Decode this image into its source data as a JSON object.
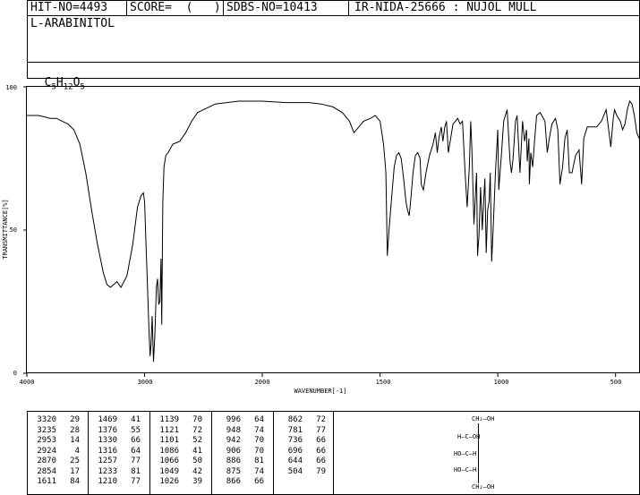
{
  "header": {
    "hit": "HIT-NO=4493",
    "score": "SCORE=  (   )",
    "sdbs": "SDBS-NO=10413",
    "ir": "IR-NIDA-25666 : NUJOL MULL",
    "compound": "L-ARABINITOL",
    "formula": {
      "c": "C",
      "c_n": "5",
      "h": "H",
      "h_n": "12",
      "o": "O",
      "o_n": "5"
    }
  },
  "chart_data": {
    "type": "line",
    "xlabel": "WAVENUMBER[-1]",
    "ylabel": "TRANSMITTANCE[%]",
    "xlim": [
      4000,
      400
    ],
    "ylim": [
      0,
      100
    ],
    "x_ticks": [
      "4000",
      "3000",
      "2000",
      "1500",
      "1000",
      "500"
    ],
    "y_ticks": [
      "100",
      "50",
      "0"
    ],
    "series": [
      {
        "x": [
          4000,
          3900,
          3800,
          3750,
          3700,
          3650,
          3600,
          3550,
          3500,
          3450,
          3400,
          3350,
          3320,
          3290,
          3260,
          3235,
          3200,
          3150,
          3100,
          3060,
          3030,
          3010,
          3000,
          2990,
          2975,
          2960,
          2953,
          2945,
          2935,
          2924,
          2912,
          2900,
          2890,
          2880,
          2870,
          2860,
          2854,
          2845,
          2835,
          2820,
          2800,
          2760,
          2700,
          2650,
          2600,
          2550,
          2500,
          2450,
          2400,
          2300,
          2200,
          2100,
          2000,
          1900,
          1800,
          1750,
          1700,
          1660,
          1630,
          1611,
          1590,
          1570,
          1540,
          1520,
          1500,
          1485,
          1475,
          1469,
          1462,
          1450,
          1440,
          1430,
          1420,
          1410,
          1400,
          1390,
          1383,
          1376,
          1368,
          1360,
          1350,
          1340,
          1330,
          1325,
          1316,
          1305,
          1290,
          1275,
          1265,
          1257,
          1250,
          1240,
          1233,
          1225,
          1218,
          1210,
          1200,
          1190,
          1180,
          1170,
          1160,
          1150,
          1139,
          1130,
          1121,
          1115,
          1110,
          1101,
          1095,
          1090,
          1086,
          1080,
          1073,
          1066,
          1060,
          1055,
          1049,
          1043,
          1037,
          1032,
          1026,
          1020,
          1010,
          1000,
          996,
          985,
          975,
          960,
          948,
          942,
          935,
          925,
          918,
          912,
          906,
          895,
          886,
          878,
          875,
          868,
          866,
          860,
          852,
          845,
          835,
          820,
          800,
          790,
          781,
          770,
          755,
          745,
          736,
          725,
          715,
          705,
          696,
          685,
          670,
          655,
          644,
          635,
          620,
          600,
          580,
          560,
          540,
          520,
          510,
          504,
          495,
          480,
          470,
          460,
          450,
          440,
          430,
          420,
          410,
          400
        ],
        "y": [
          90,
          90,
          89,
          89,
          88,
          87,
          85,
          80,
          70,
          57,
          45,
          35,
          31,
          30,
          31,
          32,
          30,
          34,
          45,
          58,
          62,
          63,
          60,
          48,
          30,
          12,
          6,
          10,
          20,
          4,
          14,
          30,
          33,
          24,
          25,
          40,
          17,
          60,
          72,
          76,
          77,
          80,
          81,
          84,
          88,
          91,
          92,
          93,
          94,
          94.5,
          95,
          95,
          95,
          94.5,
          94.5,
          94,
          93,
          91,
          88,
          84,
          86,
          88,
          89,
          90,
          88,
          80,
          70,
          41,
          50,
          62,
          72,
          76,
          77,
          75,
          68,
          60,
          57,
          55,
          62,
          70,
          76,
          77,
          75,
          66,
          64,
          70,
          76,
          80,
          84,
          77,
          82,
          86,
          81,
          86,
          88,
          77,
          82,
          87,
          88,
          89,
          87,
          88,
          70,
          58,
          72,
          88,
          78,
          52,
          62,
          70,
          41,
          48,
          65,
          50,
          60,
          68,
          42,
          57,
          60,
          70,
          39,
          50,
          70,
          85,
          64,
          76,
          88,
          92,
          74,
          70,
          75,
          88,
          90,
          80,
          70,
          88,
          81,
          85,
          74,
          82,
          66,
          77,
          72,
          80,
          90,
          91,
          88,
          77,
          82,
          87,
          89,
          85,
          66,
          72,
          82,
          85,
          70,
          70,
          76,
          78,
          66,
          82,
          86,
          86,
          86,
          88,
          92,
          79,
          89,
          92,
          90,
          88,
          85,
          87,
          92,
          95,
          94,
          90,
          84,
          82
        ]
      }
    ]
  },
  "peak_table": [
    [
      [
        "3320",
        "29"
      ],
      [
        "3235",
        "28"
      ],
      [
        "2953",
        "14"
      ],
      [
        "2924",
        "4"
      ],
      [
        "2870",
        "25"
      ],
      [
        "2854",
        "17"
      ],
      [
        "1611",
        "84"
      ]
    ],
    [
      [
        "1469",
        "41"
      ],
      [
        "1376",
        "55"
      ],
      [
        "1330",
        "66"
      ],
      [
        "1316",
        "64"
      ],
      [
        "1257",
        "77"
      ],
      [
        "1233",
        "81"
      ],
      [
        "1210",
        "77"
      ]
    ],
    [
      [
        "1139",
        "70"
      ],
      [
        "1121",
        "72"
      ],
      [
        "1101",
        "52"
      ],
      [
        "1086",
        "41"
      ],
      [
        "1066",
        "50"
      ],
      [
        "1049",
        "42"
      ],
      [
        "1026",
        "39"
      ]
    ],
    [
      [
        "996",
        "64"
      ],
      [
        "948",
        "74"
      ],
      [
        "942",
        "70"
      ],
      [
        "906",
        "70"
      ],
      [
        "886",
        "81"
      ],
      [
        "875",
        "74"
      ],
      [
        "866",
        "66"
      ]
    ],
    [
      [
        "862",
        "72"
      ],
      [
        "781",
        "77"
      ],
      [
        "736",
        "66"
      ],
      [
        "696",
        "66"
      ],
      [
        "644",
        "66"
      ],
      [
        "504",
        "79"
      ]
    ]
  ],
  "structure": {
    "top": "CH₂—OH",
    "row1": "H—C—OH",
    "row2": "HO—C—H",
    "row3": "HO—C—H",
    "bottom": "CH₂—OH"
  }
}
